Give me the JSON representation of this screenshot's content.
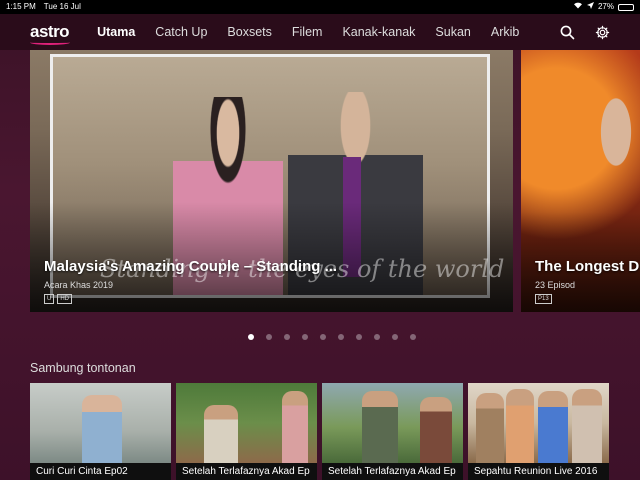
{
  "status": {
    "time": "1:15 PM",
    "date": "Tue 16 Jul",
    "battery": "27%",
    "battery_level": 0.27
  },
  "nav": {
    "logo": "astro",
    "items": [
      "Utama",
      "Catch Up",
      "Boxsets",
      "Filem",
      "Kanak-kanak",
      "Sukan",
      "Arkib"
    ],
    "active_index": 0,
    "icons": [
      "search-icon",
      "settings-icon"
    ]
  },
  "hero": {
    "slides": [
      {
        "title": "Malaysia's Amazing Couple – Standing ...",
        "meta": "Acara Khas  2019",
        "badges": [
          "U",
          "HD"
        ],
        "overlay_text": "Standing in the eyes of the world"
      },
      {
        "title": "The Longest D",
        "meta": "23 Episod",
        "badges": [
          "P13"
        ]
      }
    ],
    "dot_count": 10,
    "active_dot": 0
  },
  "continue_watching": {
    "title": "Sambung tontonan",
    "items": [
      "Curi Curi Cinta Ep02",
      "Setelah Terlafaznya Akad Ep",
      "Setelah Terlafaznya Akad Ep",
      "Sepahtu Reunion Live 2016",
      ""
    ]
  },
  "colors": {
    "background": "#4a1630",
    "navbar": "#2a0c1a",
    "accent": "#e0217a"
  }
}
